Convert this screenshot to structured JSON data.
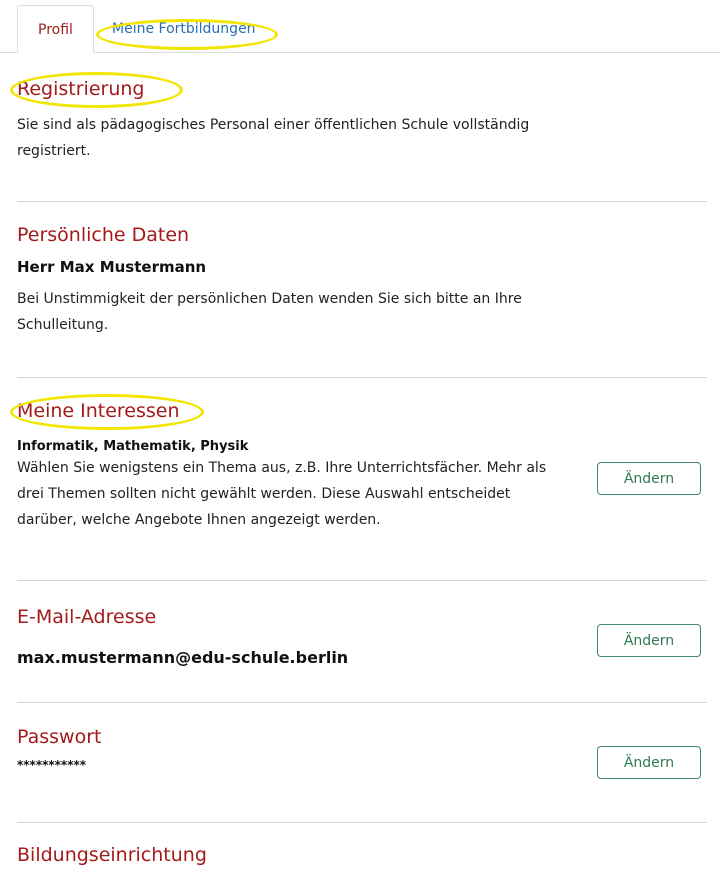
{
  "tabs": [
    {
      "label": "Profil",
      "active": true
    },
    {
      "label": "Meine Fortbildungen",
      "active": false
    }
  ],
  "registration": {
    "heading": "Registrierung",
    "text": "Sie sind als pädagogisches Personal einer öffentlichen Schule vollständig registriert."
  },
  "personal": {
    "heading": "Persönliche Daten",
    "name": "Herr Max Mustermann",
    "text": "Bei Unstimmigkeit der persönlichen Daten wenden Sie sich bitte an Ihre Schulleitung."
  },
  "interests": {
    "heading": "Meine Interessen",
    "topics": "Informatik, Mathematik, Physik",
    "text": "Wählen Sie wenigstens ein Thema aus, z.B. Ihre Unterrichtsfächer. Mehr als drei Themen sollten nicht gewählt werden. Diese Auswahl entscheidet darüber, welche Angebote Ihnen angezeigt werden.",
    "button": "Ändern"
  },
  "email": {
    "heading": "E-Mail-Adresse",
    "value": "max.mustermann@edu-schule.berlin",
    "button": "Ändern"
  },
  "password": {
    "heading": "Passwort",
    "value": "***********",
    "button": "Ändern"
  },
  "institution": {
    "heading": "Bildungseinrichtung"
  },
  "colors": {
    "heading": "#a31a1a",
    "link": "#2a6fb5",
    "button": "#2f7a52",
    "highlight": "#f2e500"
  }
}
